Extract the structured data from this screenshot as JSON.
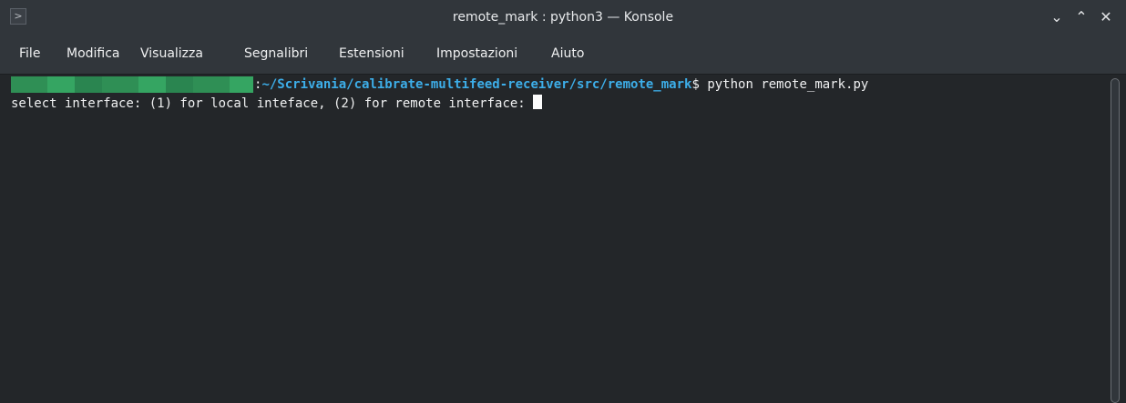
{
  "window": {
    "title": "remote_mark : python3 — Konsole",
    "icon": "terminal-icon",
    "controls": {
      "minimize": "⌄",
      "maximize": "⌃",
      "close": "✕"
    }
  },
  "menu": {
    "items": [
      "File",
      "Modifica",
      "Visualizza",
      "Segnalibri",
      "Estensioni",
      "Impostazioni",
      "Aiuto"
    ]
  },
  "terminal": {
    "prompt_colon": ":",
    "prompt_path": "~/Scrivania/calibrate-multifeed-receiver/src/remote_mark",
    "prompt_dollar": "$",
    "command": " python remote_mark.py",
    "output_line": "select interface: (1) for local inteface, (2) for remote interface: "
  },
  "colors": {
    "path": "#3daee9",
    "redacted": "#2f8f55",
    "background": "#232629"
  }
}
